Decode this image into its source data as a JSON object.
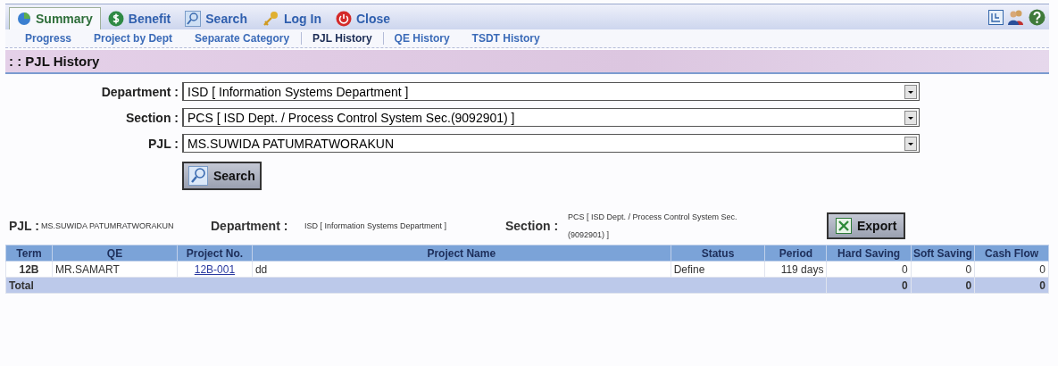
{
  "tabs": [
    {
      "label": "Summary",
      "selected": true
    },
    {
      "label": "Benefit",
      "selected": false
    },
    {
      "label": "Search",
      "selected": false
    },
    {
      "label": "Log In",
      "selected": false
    },
    {
      "label": "Close",
      "selected": false
    }
  ],
  "subtabs": [
    {
      "label": "Progress",
      "selected": false
    },
    {
      "label": "Project by Dept",
      "selected": false
    },
    {
      "label": "Separate Category",
      "selected": false
    },
    {
      "label": "PJL History",
      "selected": true
    },
    {
      "label": "QE History",
      "selected": false
    },
    {
      "label": "TSDT History",
      "selected": false
    }
  ],
  "section_title": ": : PJL History",
  "filters": [
    {
      "label": "Department :",
      "value": "ISD [ Information Systems Department ]"
    },
    {
      "label": "Section :",
      "value": "PCS [ ISD Dept. / Process Control System Sec.(9092901) ]"
    },
    {
      "label": "PJL :",
      "value": "MS.SUWIDA PATUMRATWORAKUN"
    }
  ],
  "search_button": "Search",
  "summary": [
    {
      "label": "PJL :",
      "value": "MS.SUWIDA PATUMRATWORAKUN"
    },
    {
      "label": "Department :",
      "value": "ISD [ Information Systems Department ]"
    },
    {
      "label": "Section :",
      "value": "PCS [ ISD Dept. / Process Control System Sec. (9092901) ]"
    }
  ],
  "export_button": "Export",
  "table": {
    "columns": [
      "Term",
      "QE",
      "Project No.",
      "Project Name",
      "Status",
      "Period",
      "Hard Saving",
      "Soft Saving",
      "Cash Flow"
    ],
    "rows": [
      [
        "12B",
        "MR.SAMART",
        "12B-001",
        "dd",
        "Define",
        "119 days",
        "0",
        "0",
        "0"
      ]
    ],
    "total": {
      "label": "Total",
      "values": [
        "0",
        "0",
        "0"
      ]
    }
  }
}
